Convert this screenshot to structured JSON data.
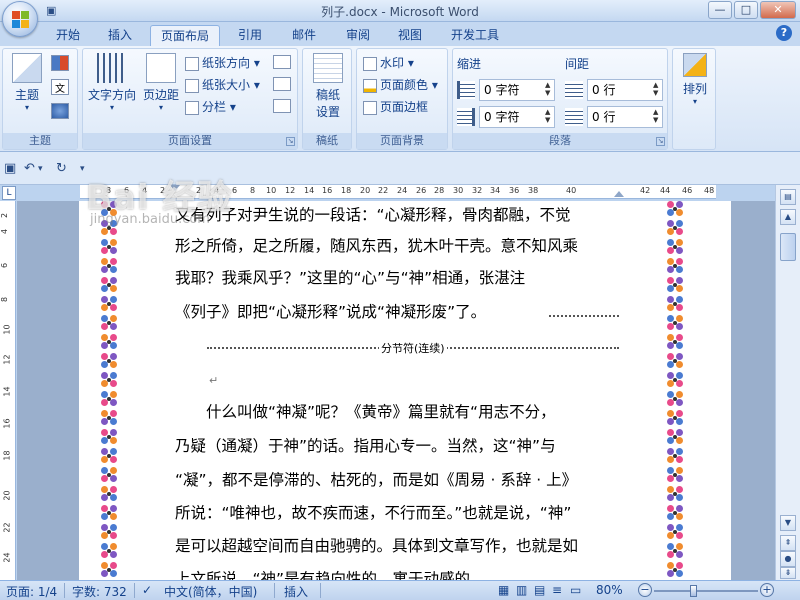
{
  "window": {
    "title": "列子.docx - Microsoft Word"
  },
  "tabs": [
    {
      "label": "开始"
    },
    {
      "label": "插入"
    },
    {
      "label": "页面布局",
      "active": true
    },
    {
      "label": "引用"
    },
    {
      "label": "邮件"
    },
    {
      "label": "审阅"
    },
    {
      "label": "视图"
    },
    {
      "label": "开发工具"
    }
  ],
  "ribbon": {
    "theme": {
      "label": "主题",
      "group_label": "主题"
    },
    "page_setup": {
      "text_direction": "文字方向",
      "margins": "页边距",
      "orientation": "纸张方向",
      "size": "纸张大小",
      "columns": "分栏",
      "group_label": "页面设置"
    },
    "manuscript": {
      "label": "稿纸\n设置",
      "group_label": "稿纸"
    },
    "page_background": {
      "watermark": "水印",
      "page_color": "页面颜色",
      "page_borders": "页面边框",
      "group_label": "页面背景"
    },
    "paragraph": {
      "indent_label": "缩进",
      "spacing_label": "间距",
      "indent_left": "0 字符",
      "indent_right": "0 字符",
      "spacing_before": "0 行",
      "spacing_after": "0 行",
      "group_label": "段落"
    },
    "arrange": {
      "label": "排列"
    }
  },
  "document": {
    "lines": [
      "又有列子对尹生说的一段话：“心凝形释，骨肉都融，不觉",
      "形之所倚，足之所履，随风东西，犹木叶干壳。意不知风乘",
      "我耶？我乘风乎？”这里的“心”与“神”相通，张湛注",
      "《列子》即把“心凝形释”说成“神凝形废”了。",
      "　　什么叫做“神凝”呢？《黄帝》篇里就有“用志不分，",
      "乃疑（通凝）于神”的话。指用心专一。当然，这“神”与",
      "“凝”，都不是停滞的、枯死的，而是如《周易 · 系辞 · 上》",
      "所说：“唯神也，故不疾而速，不行而至。”也就是说，“神”",
      "是可以超越空间而自由驰骋的。具体到文章写作，也就是如",
      "上文所说，“神”是有趋向性的，寓于动感的。"
    ],
    "section_break": "分节符(连续)",
    "pilcrow": "↵"
  },
  "ruler": {
    "h_ticks": [
      "8",
      "6",
      "4",
      "2",
      "2",
      "4",
      "6",
      "8",
      "10",
      "12",
      "14",
      "16",
      "18",
      "20",
      "22",
      "24",
      "26",
      "28",
      "30",
      "32",
      "34",
      "36",
      "38",
      "40",
      "42",
      "44",
      "46",
      "48"
    ],
    "v_ticks": [
      "2",
      "4",
      "6",
      "8",
      "10",
      "12",
      "14",
      "16",
      "18",
      "20",
      "22",
      "24"
    ]
  },
  "status": {
    "page": "页面: 1/4",
    "words": "字数: 732",
    "language": "中文(简体，中国)",
    "mode": "插入",
    "zoom": "80%",
    "zoom_level": 0.8
  },
  "watermark": {
    "text": "Bai 经验",
    "sub": "jingyan.baidu.com"
  },
  "colors": {
    "accent": "#15428b",
    "ribbon": "#d6e4f6"
  }
}
